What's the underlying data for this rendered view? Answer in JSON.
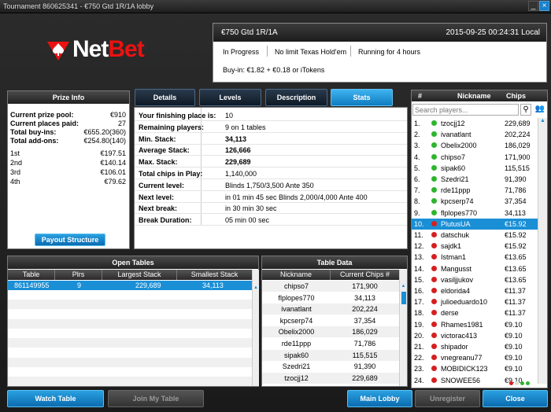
{
  "window": {
    "title": "Tournament 860625341 - €750 Gtd 1R/1A lobby",
    "controls": [
      "_",
      "×"
    ]
  },
  "brand": {
    "name_white": "Net",
    "name_red": "Bet"
  },
  "tournament": {
    "name": "€750 Gtd 1R/1A",
    "datetime": "2015-09-25 00:24:31 Local",
    "status": "In Progress",
    "game": "No limit Texas Hold'em",
    "running": "Running for 4 hours",
    "buyin": "Buy-in: €1.82 + €0.18 or iTokens"
  },
  "prize_info": {
    "title": "Prize Info",
    "summary": [
      {
        "label": "Current prize pool:",
        "value": "€910"
      },
      {
        "label": "Current places paid:",
        "value": "27"
      },
      {
        "label": "Total buy-ins:",
        "value": "€655.20(360)"
      },
      {
        "label": "Total add-ons:",
        "value": "€254.80(140)"
      }
    ],
    "places": [
      {
        "place": "1st",
        "amount": "€197.51"
      },
      {
        "place": "2nd",
        "amount": "€140.14"
      },
      {
        "place": "3rd",
        "amount": "€106.01"
      },
      {
        "place": "4th",
        "amount": "€79.62"
      }
    ],
    "payout_button": "Payout Structure"
  },
  "tabs": [
    "Details",
    "Levels",
    "Description",
    "Stats"
  ],
  "active_tab": "Stats",
  "stats": [
    {
      "label": "Your finishing place is:",
      "value": "10"
    },
    {
      "label": "Remaining players:",
      "value": "9 on 1 tables"
    },
    {
      "label": "Min. Stack:",
      "value": "34,113"
    },
    {
      "label": "Average Stack:",
      "value": "126,666"
    },
    {
      "label": "Max. Stack:",
      "value": "229,689"
    },
    {
      "label": "Total chips in Play:",
      "value": "1,140,000"
    },
    {
      "label": "Current level:",
      "value": "Blinds 1,750/3,500 Ante 350"
    },
    {
      "label": "Next level:",
      "value": "in 01 min 45 sec  Blinds 2,000/4,000 Ante 400"
    },
    {
      "label": "Next break:",
      "value": "in 30 min 30 sec"
    },
    {
      "label": "Break Duration:",
      "value": "05 min 00 sec"
    }
  ],
  "players": {
    "headers": [
      "#",
      "Nickname",
      "Chips"
    ],
    "search_placeholder": "Search players...",
    "rows": [
      {
        "n": "1.",
        "name": "tzocjj12",
        "chips": "229,689",
        "status": "green"
      },
      {
        "n": "2.",
        "name": "ivanatlant",
        "chips": "202,224",
        "status": "green"
      },
      {
        "n": "3.",
        "name": "Obelix2000",
        "chips": "186,029",
        "status": "green"
      },
      {
        "n": "4.",
        "name": "chipso7",
        "chips": "171,900",
        "status": "green"
      },
      {
        "n": "5.",
        "name": "sipak60",
        "chips": "115,515",
        "status": "green"
      },
      {
        "n": "6.",
        "name": "Szedri21",
        "chips": "91,390",
        "status": "green"
      },
      {
        "n": "7.",
        "name": "rde11ppp",
        "chips": "71,786",
        "status": "green"
      },
      {
        "n": "8.",
        "name": "kpcserp74",
        "chips": "37,354",
        "status": "green"
      },
      {
        "n": "9.",
        "name": "flplopes770",
        "chips": "34,113",
        "status": "green"
      },
      {
        "n": "10.",
        "name": "PlutusUA",
        "chips": "€15.92",
        "status": "red"
      },
      {
        "n": "11.",
        "name": "datschuk",
        "chips": "€15.92",
        "status": "red"
      },
      {
        "n": "12.",
        "name": "sajdk1",
        "chips": "€15.92",
        "status": "red"
      },
      {
        "n": "13.",
        "name": "Istman1",
        "chips": "€13.65",
        "status": "red"
      },
      {
        "n": "14.",
        "name": "Mangusst",
        "chips": "€13.65",
        "status": "red"
      },
      {
        "n": "15.",
        "name": "vasiljjukov",
        "chips": "€13.65",
        "status": "red"
      },
      {
        "n": "16.",
        "name": "eldorida4",
        "chips": "€11.37",
        "status": "red"
      },
      {
        "n": "17.",
        "name": "julioeduardo10",
        "chips": "€11.37",
        "status": "red"
      },
      {
        "n": "18.",
        "name": "derse",
        "chips": "€11.37",
        "status": "red"
      },
      {
        "n": "19.",
        "name": "Rhames1981",
        "chips": "€9.10",
        "status": "red"
      },
      {
        "n": "20.",
        "name": "victorac413",
        "chips": "€9.10",
        "status": "red"
      },
      {
        "n": "21.",
        "name": "shipador",
        "chips": "€9.10",
        "status": "red"
      },
      {
        "n": "22.",
        "name": "vnegreanu77",
        "chips": "€9.10",
        "status": "red"
      },
      {
        "n": "23.",
        "name": "MOBIDICK123",
        "chips": "€9.10",
        "status": "red"
      },
      {
        "n": "24.",
        "name": "SNOWEE56",
        "chips": "€9.10",
        "status": "red"
      }
    ],
    "selected_index": 9
  },
  "open_tables": {
    "title": "Open Tables",
    "headers": [
      "Table",
      "Plrs",
      "Largest Stack",
      "Smallest Stack"
    ],
    "rows": [
      {
        "table": "861149955",
        "plrs": "9",
        "largest": "229,689",
        "smallest": "34,113"
      }
    ]
  },
  "table_data": {
    "title": "Table Data",
    "headers": [
      "Nickname",
      "Current Chips #"
    ],
    "rows": [
      {
        "name": "chipso7",
        "chips": "171,900"
      },
      {
        "name": "flplopes770",
        "chips": "34,113"
      },
      {
        "name": "ivanatlant",
        "chips": "202,224"
      },
      {
        "name": "kpcserp74",
        "chips": "37,354"
      },
      {
        "name": "Obelix2000",
        "chips": "186,029"
      },
      {
        "name": "rde11ppp",
        "chips": "71,786"
      },
      {
        "name": "sipak60",
        "chips": "115,515"
      },
      {
        "name": "Szedri21",
        "chips": "91,390"
      },
      {
        "name": "tzocjj12",
        "chips": "229,689"
      }
    ]
  },
  "buttons": {
    "watch": "Watch Table",
    "join": "Join My Table",
    "lobby": "Main Lobby",
    "unregister": "Unregister",
    "close": "Close"
  },
  "colors": {
    "accent": "#1a8fd6",
    "selected": "#1a8fd6",
    "online": "#2db52d",
    "offline": "#d42020"
  }
}
